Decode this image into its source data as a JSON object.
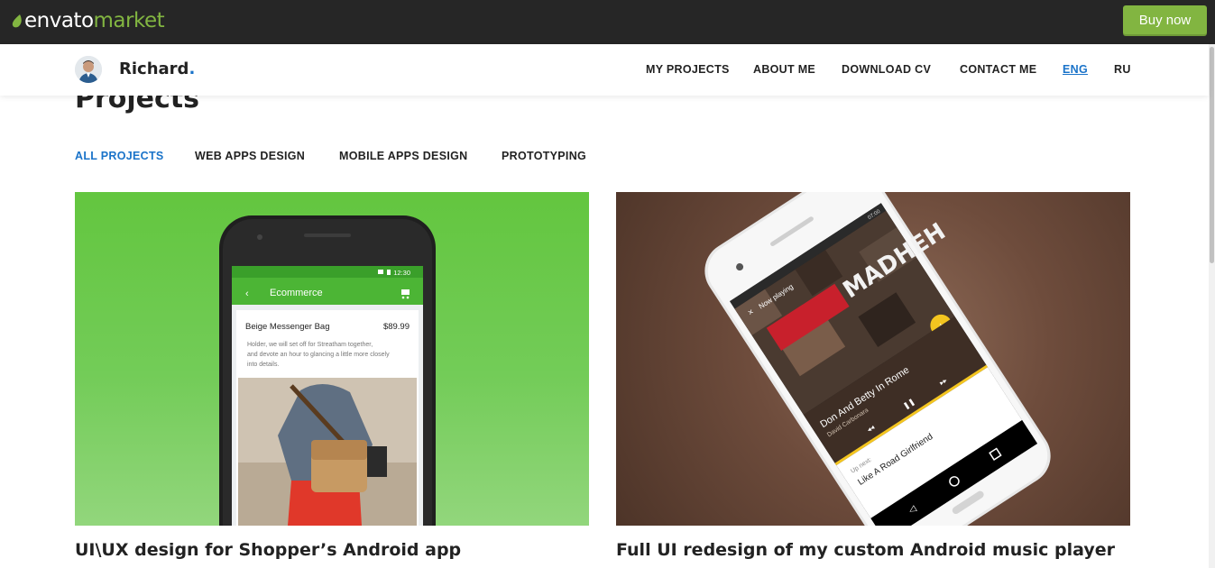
{
  "envato": {
    "logo_word1": "envato",
    "logo_word2": "market",
    "buy_label": "Buy now",
    "accent": "#82b541"
  },
  "header": {
    "brand": "Richard",
    "brand_dot": ".",
    "nav": [
      {
        "label": "MY PROJECTS"
      },
      {
        "label": "ABOUT ME"
      },
      {
        "label": "DOWNLOAD CV"
      },
      {
        "label": "CONTACT ME"
      },
      {
        "label": "ENG",
        "active": true
      },
      {
        "label": "RU"
      }
    ]
  },
  "projects": {
    "title": "Projects",
    "filters": [
      {
        "label": "ALL PROJECTS",
        "active": true
      },
      {
        "label": "WEB APPS DESIGN"
      },
      {
        "label": "MOBILE APPS DESIGN"
      },
      {
        "label": "PROTOTYPING"
      }
    ],
    "cards": [
      {
        "title": "UI\\UX design for Shopper’s Android app",
        "phone": {
          "status_time": "12:30",
          "app_title": "Ecommerce",
          "product_name": "Beige Messenger Bag",
          "price": "$89.99",
          "description_lines": [
            "Holder, we will set off for Streatham together,",
            "and devote an hour to glancing a little more closely",
            "into details."
          ]
        }
      },
      {
        "title": "Full UI redesign of my custom Android music player",
        "phone": {
          "status_time": "07:00",
          "header": "Now playing",
          "cover_text": "MADHEH",
          "song": "Don And Betty In Rome",
          "artist": "David Carbonara",
          "up_next_label": "Up next:",
          "up_next_song": "Like A Road Girlfriend"
        }
      }
    ]
  },
  "colors": {
    "link_blue": "#1a73c9",
    "green_card": "#63c63f",
    "brown_card": "#6e4c3c"
  }
}
